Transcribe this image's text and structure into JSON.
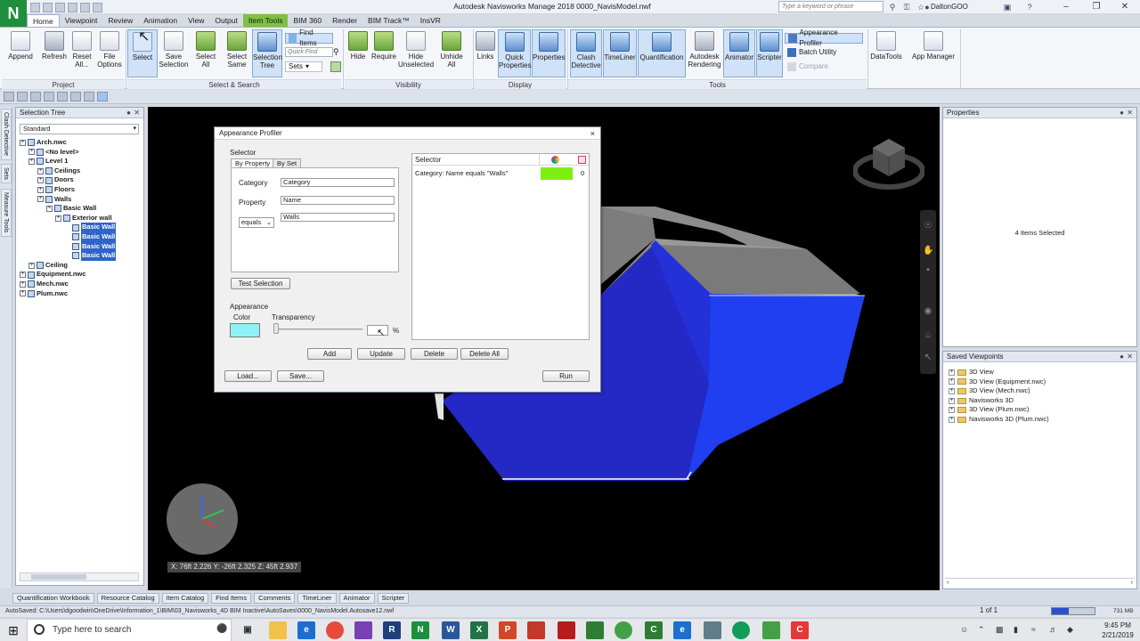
{
  "titlebar": {
    "title": "Autodesk Navisworks Manage 2018    0000_NavisModel.nwf",
    "search_placeholder": "Type a keyword or phrase",
    "user": "DaltonGOO",
    "logo_letter": "N"
  },
  "ribbon_tabs": [
    "Home",
    "Viewpoint",
    "Review",
    "Animation",
    "View",
    "Output",
    "Item Tools",
    "BIM 360",
    "Render",
    "BIM Track™",
    "InsVR"
  ],
  "ribbon": {
    "project": {
      "label": "Project",
      "buttons": [
        "Append",
        "Refresh",
        "Reset All...",
        "File Options"
      ]
    },
    "select_search": {
      "label": "Select & Search",
      "buttons": [
        "Select",
        "Save Selection",
        "Select All",
        "Select Same",
        "Selection Tree"
      ],
      "find_items": "Find Items",
      "quick_find_placeholder": "Quick Find",
      "sets": "Sets"
    },
    "visibility": {
      "label": "Visibility",
      "buttons": [
        "Hide",
        "Require",
        "Hide Unselected",
        "Unhide All"
      ]
    },
    "display": {
      "label": "Display",
      "buttons": [
        "Links",
        "Quick Properties",
        "Properties"
      ]
    },
    "tools": {
      "label": "Tools",
      "buttons": [
        "Clash Detective",
        "TimeLiner",
        "Quantification",
        "Autodesk Rendering",
        "Animator",
        "Scripter"
      ],
      "appearance_profiler": "Appearance Profiler",
      "batch_utility": "Batch Utility",
      "compare": "Compare"
    },
    "extra": [
      "DataTools",
      "App Manager"
    ]
  },
  "side_tabs": [
    "Clash Detective",
    "Sets",
    "Measure Tools"
  ],
  "selection_tree": {
    "title": "Selection Tree",
    "mode": "Standard",
    "items": [
      {
        "label": "Arch.nwc",
        "level": 0
      },
      {
        "label": "<No level>",
        "level": 1
      },
      {
        "label": "Level 1",
        "level": 1
      },
      {
        "label": "Ceilings",
        "level": 2
      },
      {
        "label": "Doors",
        "level": 2
      },
      {
        "label": "Floors",
        "level": 2
      },
      {
        "label": "Walls",
        "level": 2
      },
      {
        "label": "Basic Wall",
        "level": 3
      },
      {
        "label": "Exterior wall",
        "level": 4
      },
      {
        "label": "Basic Wall",
        "level": 5,
        "selected": true
      },
      {
        "label": "Basic Wall",
        "level": 5,
        "selected": true
      },
      {
        "label": "Basic Wall",
        "level": 5,
        "selected": true
      },
      {
        "label": "Basic Wall",
        "level": 5,
        "selected": true
      },
      {
        "label": "Ceiling",
        "level": 1
      },
      {
        "label": "Equipment.nwc",
        "level": 0
      },
      {
        "label": "Mech.nwc",
        "level": 0
      },
      {
        "label": "Plum.nwc",
        "level": 0
      }
    ]
  },
  "viewport": {
    "coords": "X: 76ft 2.226  Y: -26ft 2.325  Z: 45ft 2.937",
    "colors": {
      "roof": "#8a8a8a",
      "wall": "#1f3ff0",
      "ceiling": "#2a30c8",
      "background": "#000000"
    }
  },
  "dialog": {
    "title": "Appearance Profiler",
    "close": "×",
    "selector_label": "Selector",
    "tabs": [
      "By Property",
      "By Set"
    ],
    "category_label": "Category",
    "category_value": "Category",
    "property_label": "Property",
    "property_value": "Name",
    "operator": "equals",
    "value": "Walls",
    "test_selection": "Test Selection",
    "appearance_label": "Appearance",
    "color_label": "Color",
    "transparency_label": "Transparency",
    "transparency_value": "",
    "percent_sign": "%",
    "list_header": "Selector",
    "list_rows": [
      {
        "selector": "Category: Name equals \"Walls\"",
        "color": "#7cf011",
        "transparency": "0"
      }
    ],
    "buttons": {
      "add": "Add",
      "update": "Update",
      "delete": "Delete",
      "delete_all": "Delete All",
      "load": "Load...",
      "save": "Save...",
      "run": "Run"
    }
  },
  "properties": {
    "title": "Properties",
    "status": "4 Items Selected"
  },
  "saved_viewpoints": {
    "title": "Saved Viewpoints",
    "items": [
      "3D View",
      "3D View (Equipment.nwc)",
      "3D View (Mech.nwc)",
      "Navisworks 3D",
      "3D View (Plum.nwc)",
      "Navisworks 3D (Plum.nwc)"
    ]
  },
  "bottom_tabs": [
    "Quantification Workbook",
    "Resource Catalog",
    "Item Catalog",
    "Find Items",
    "Comments",
    "TimeLiner",
    "Animator",
    "Scripter"
  ],
  "status": {
    "autosave": "AutoSaved: C:\\Users\\dgoodwin\\OneDrive\\Information_1\\BIM\\03_Navisworks_4D BIM Inactive\\AutoSaves\\0000_NavisModel.Autosave12.nwf",
    "page": "1 of 1",
    "memory": "731 MB"
  },
  "taskbar": {
    "search_placeholder": "Type here to search",
    "time": "9:45 PM",
    "date": "2/21/2019"
  }
}
